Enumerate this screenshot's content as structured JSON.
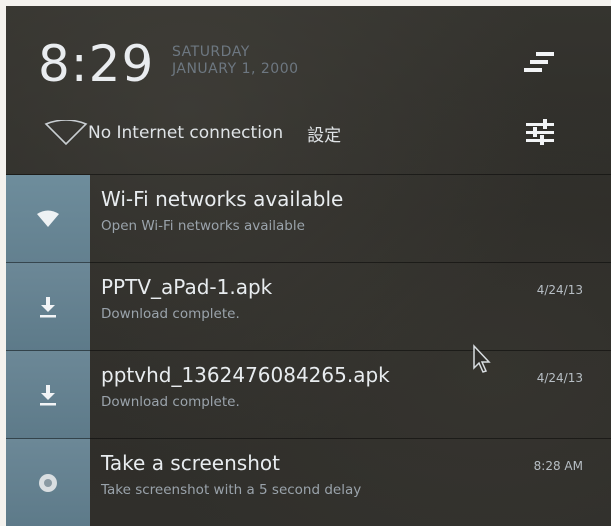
{
  "status": {
    "time": "8:29",
    "day": "SATURDAY",
    "date": "JANUARY 1, 2000",
    "connection": "No Internet connection",
    "settings_label": "設定"
  },
  "icons": {
    "quick_settings": "quick-settings-icon",
    "toggles": "toggles-icon",
    "wifi_outline": "wifi-outline-icon"
  },
  "notifications": [
    {
      "icon": "wifi-icon",
      "title": "Wi-Fi networks available",
      "subtitle": "Open Wi-Fi networks available",
      "time": ""
    },
    {
      "icon": "download-icon",
      "title": "PPTV_aPad-1.apk",
      "subtitle": "Download complete.",
      "time": "4/24/13"
    },
    {
      "icon": "download-icon",
      "title": "pptvhd_1362476084265.apk",
      "subtitle": "Download complete.",
      "time": "4/24/13"
    },
    {
      "icon": "screenshot-icon",
      "title": "Take a screenshot",
      "subtitle": "Take screenshot with a 5 second delay",
      "time": "8:28 AM"
    }
  ],
  "colors": {
    "shade": "#302f2b",
    "icon_tile": "#6c8897",
    "text_primary": "#e8ecef",
    "text_secondary": "#9aa3ab"
  }
}
